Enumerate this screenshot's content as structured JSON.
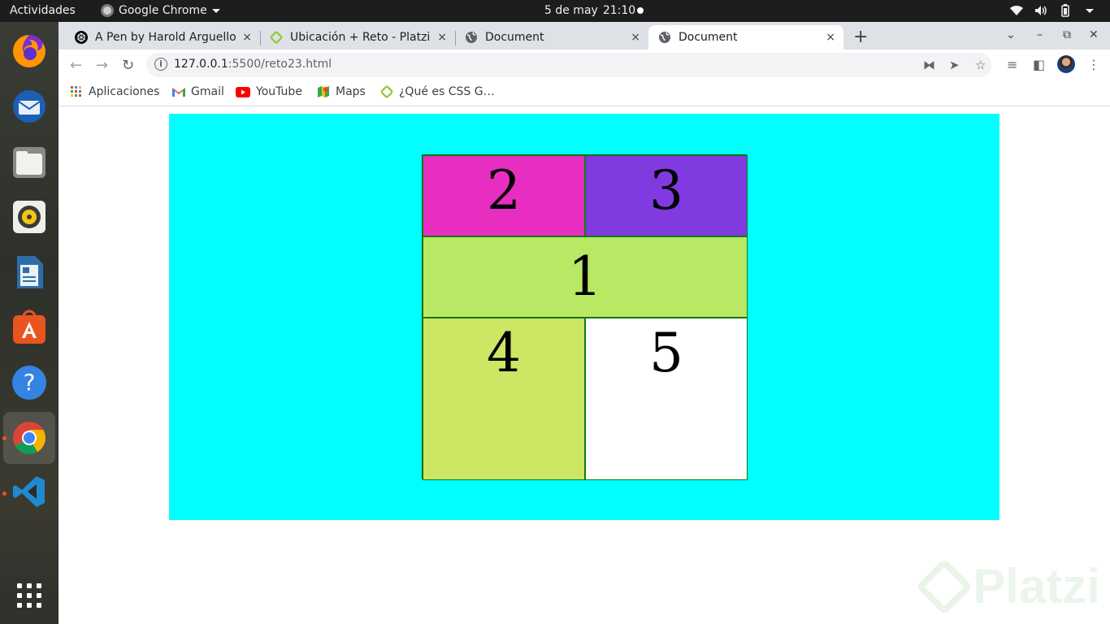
{
  "desktop": {
    "activities": "Actividades",
    "app_name": "Google Chrome",
    "clock_date": "5 de may",
    "clock_time": "21:10"
  },
  "dock": {
    "items": [
      "firefox-icon",
      "thunderbird-icon",
      "files-icon",
      "rhythmbox-icon",
      "writer-icon",
      "software-center-icon",
      "help-icon",
      "chrome-icon",
      "vscode-icon",
      "app-grid-icon"
    ]
  },
  "tabs": [
    {
      "title": "A Pen by Harold Arguello",
      "close": "×"
    },
    {
      "title": "Ubicación + Reto - Platzi",
      "close": "×"
    },
    {
      "title": "Document",
      "close": "×"
    },
    {
      "title": "Document",
      "close": "×",
      "active": true
    }
  ],
  "toolbar": {
    "url_host": "127.0.0.1",
    "url_path": ":5500/reto23.html"
  },
  "bookmarks": [
    {
      "label": "Aplicaciones",
      "icon": "apps-grid-icon"
    },
    {
      "label": "Gmail",
      "icon": "gmail-icon"
    },
    {
      "label": "YouTube",
      "icon": "youtube-icon"
    },
    {
      "label": "Maps",
      "icon": "maps-icon"
    },
    {
      "label": "¿Qué es CSS G…",
      "icon": "platzi-icon"
    }
  ],
  "page": {
    "background": "#00ffff",
    "cells": [
      {
        "label": "2",
        "color": "#e82dc1"
      },
      {
        "label": "3",
        "color": "#8139e0"
      },
      {
        "label": "1",
        "color": "#b8e864"
      },
      {
        "label": "4",
        "color": "#cde663"
      },
      {
        "label": "5",
        "color": "#ffffff"
      }
    ]
  },
  "watermark": "Platzi"
}
